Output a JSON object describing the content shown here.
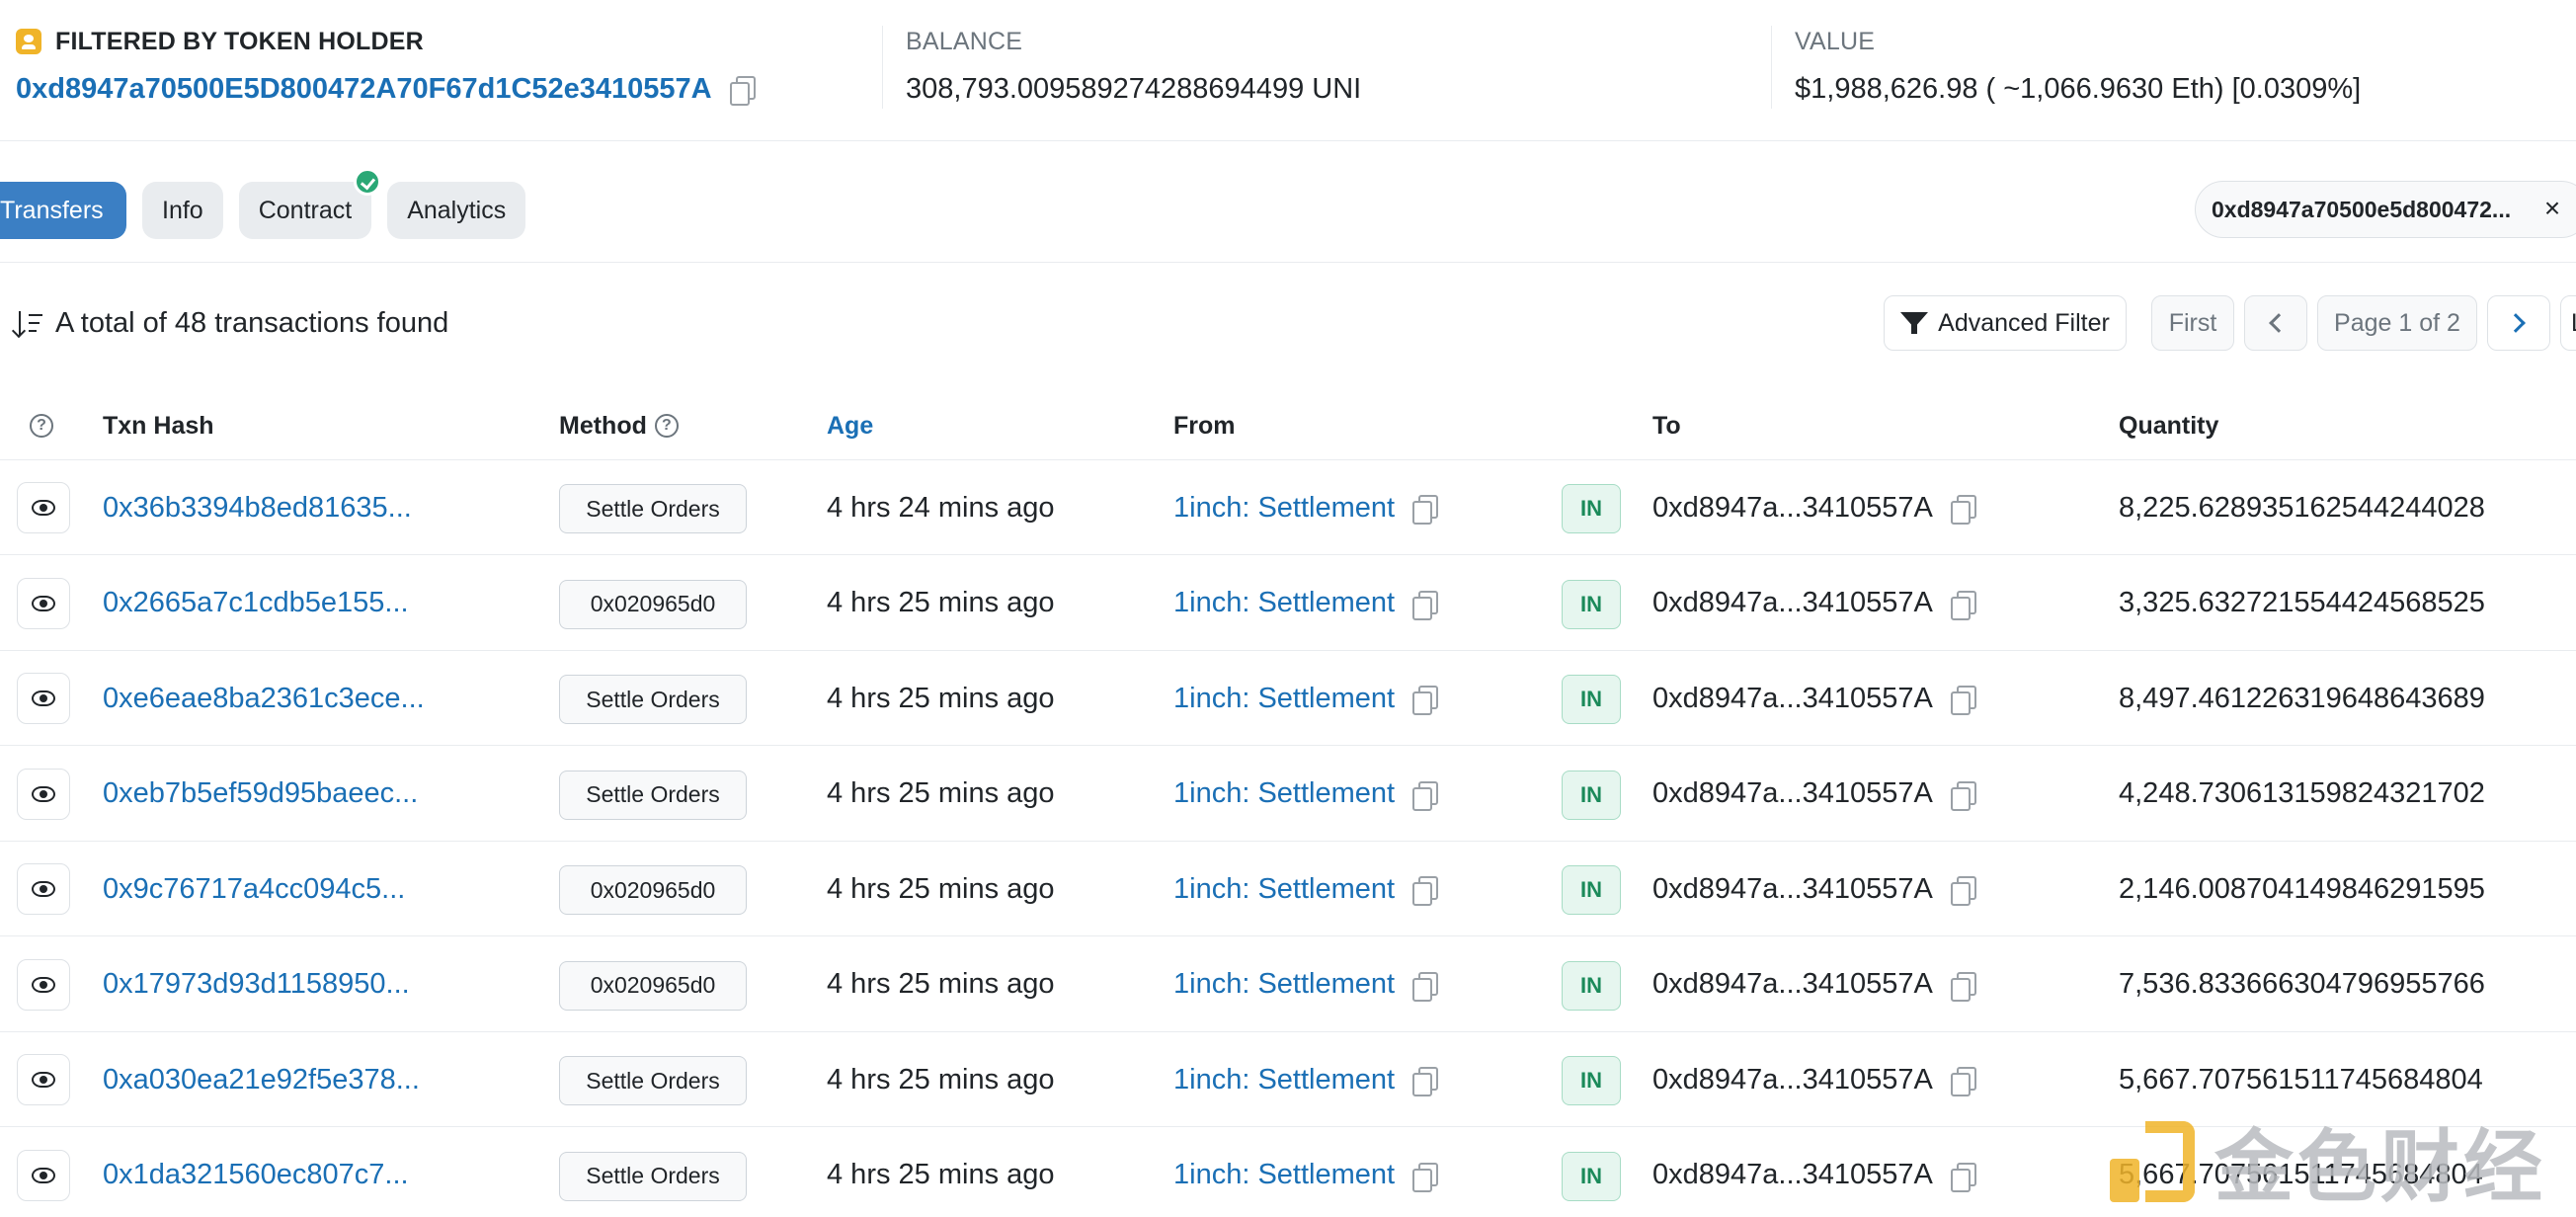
{
  "summary": {
    "filter_label": "FILTERED BY TOKEN HOLDER",
    "holder_address": "0xd8947a70500E5D800472A70F67d1C52e3410557A",
    "balance_label": "BALANCE",
    "balance_value": "308,793.009589274288694499 UNI",
    "value_label": "VALUE",
    "value_value": "$1,988,626.98 ( ~1,066.9630 Eth) [0.0309%]"
  },
  "tabs": [
    {
      "label": "Transfers",
      "active": true
    },
    {
      "label": "Info",
      "active": false
    },
    {
      "label": "Contract",
      "active": false,
      "verified": true
    },
    {
      "label": "Analytics",
      "active": false
    }
  ],
  "filter_chip": "0xd8947a70500e5d800472...",
  "toolbar": {
    "total_text": "A total of 48 transactions found",
    "advanced_filter": "Advanced Filter",
    "first": "First",
    "page_text": "Page 1 of 2",
    "last": "L"
  },
  "table": {
    "headers": {
      "txn_hash": "Txn Hash",
      "method": "Method",
      "age": "Age",
      "from": "From",
      "to": "To",
      "quantity": "Quantity"
    },
    "rows": [
      {
        "hash": "0x36b3394b8ed81635...",
        "method": "Settle Orders",
        "age": "4 hrs 24 mins ago",
        "from": "1inch: Settlement",
        "direction": "IN",
        "to": "0xd8947a...3410557A",
        "quantity": "8,225.628935162544244028"
      },
      {
        "hash": "0x2665a7c1cdb5e155...",
        "method": "0x020965d0",
        "age": "4 hrs 25 mins ago",
        "from": "1inch: Settlement",
        "direction": "IN",
        "to": "0xd8947a...3410557A",
        "quantity": "3,325.632721554424568525"
      },
      {
        "hash": "0xe6eae8ba2361c3ece...",
        "method": "Settle Orders",
        "age": "4 hrs 25 mins ago",
        "from": "1inch: Settlement",
        "direction": "IN",
        "to": "0xd8947a...3410557A",
        "quantity": "8,497.461226319648643689"
      },
      {
        "hash": "0xeb7b5ef59d95baeec...",
        "method": "Settle Orders",
        "age": "4 hrs 25 mins ago",
        "from": "1inch: Settlement",
        "direction": "IN",
        "to": "0xd8947a...3410557A",
        "quantity": "4,248.730613159824321702"
      },
      {
        "hash": "0x9c76717a4cc094c5...",
        "method": "0x020965d0",
        "age": "4 hrs 25 mins ago",
        "from": "1inch: Settlement",
        "direction": "IN",
        "to": "0xd8947a...3410557A",
        "quantity": "2,146.008704149846291595"
      },
      {
        "hash": "0x17973d93d1158950...",
        "method": "0x020965d0",
        "age": "4 hrs 25 mins ago",
        "from": "1inch: Settlement",
        "direction": "IN",
        "to": "0xd8947a...3410557A",
        "quantity": "7,536.833666304796955766"
      },
      {
        "hash": "0xa030ea21e92f5e378...",
        "method": "Settle Orders",
        "age": "4 hrs 25 mins ago",
        "from": "1inch: Settlement",
        "direction": "IN",
        "to": "0xd8947a...3410557A",
        "quantity": "5,667.707561511745684804"
      },
      {
        "hash": "0x1da321560ec807c7...",
        "method": "Settle Orders",
        "age": "4 hrs 25 mins ago",
        "from": "1inch: Settlement",
        "direction": "IN",
        "to": "0xd8947a...3410557A",
        "quantity": "5,667.707561511745684804"
      }
    ]
  },
  "watermark": "金色财经",
  "colors": {
    "link": "#1a6fb5",
    "active_tab": "#3b7fc4",
    "in_badge": "#1b8a5a",
    "verified": "#2aa876"
  }
}
